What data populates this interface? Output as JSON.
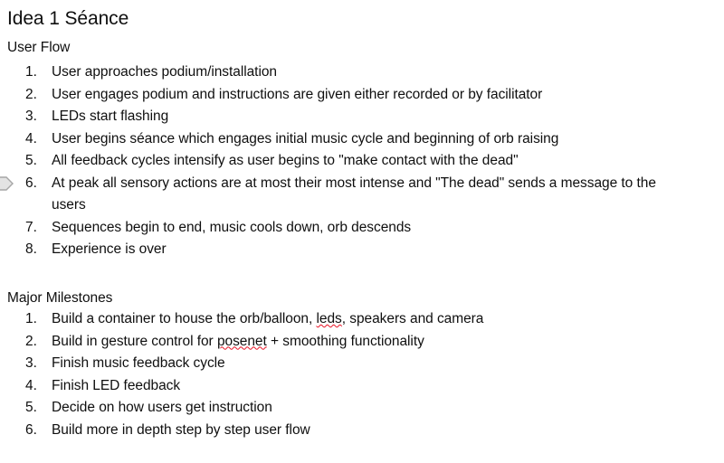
{
  "document": {
    "title": "Idea 1 Séance",
    "background_color": "#ffffff",
    "text_color": "#0f0f0f",
    "spellcheck_underline_color": "#e81123",
    "change_marker_color": "#a6a6a6"
  },
  "sections": {
    "user_flow": {
      "heading": "User Flow",
      "items": [
        {
          "number": "1.",
          "text": "User approaches podium/installation"
        },
        {
          "number": "2.",
          "text": "User engages podium and instructions are given either recorded or by facilitator"
        },
        {
          "number": "3.",
          "text": "LEDs start flashing"
        },
        {
          "number": "4.",
          "text": "User begins séance which engages initial music cycle and beginning of orb raising"
        },
        {
          "number": "5.",
          "text": "All feedback cycles intensify as user begins to \"make contact with the dead\""
        },
        {
          "number": "6.",
          "text": "At peak all sensory actions are at most their most intense and \"The dead\" sends a message to the users"
        },
        {
          "number": "7.",
          "text": "Sequences begin to end, music cools down, orb descends"
        },
        {
          "number": "8.",
          "text": "Experience is over"
        }
      ]
    },
    "major_milestones": {
      "heading": "Major Milestones",
      "items": [
        {
          "number": "1.",
          "text_before": "Build a container to house the orb/balloon, ",
          "misspelled": "leds",
          "text_after": ", speakers and camera"
        },
        {
          "number": "2.",
          "text_before": "Build in gesture control for ",
          "misspelled": "posenet",
          "text_after": " + smoothing functionality"
        },
        {
          "number": "3.",
          "text": "Finish music feedback cycle"
        },
        {
          "number": "4.",
          "text": "Finish LED feedback"
        },
        {
          "number": "5.",
          "text": "Decide on how users get instruction"
        },
        {
          "number": "6.",
          "text": "Build more in depth step by step user flow"
        }
      ]
    }
  },
  "markers": {
    "change_marker_icon": "change-marker-arrow-icon",
    "change_marker_on_item_index": 5
  }
}
